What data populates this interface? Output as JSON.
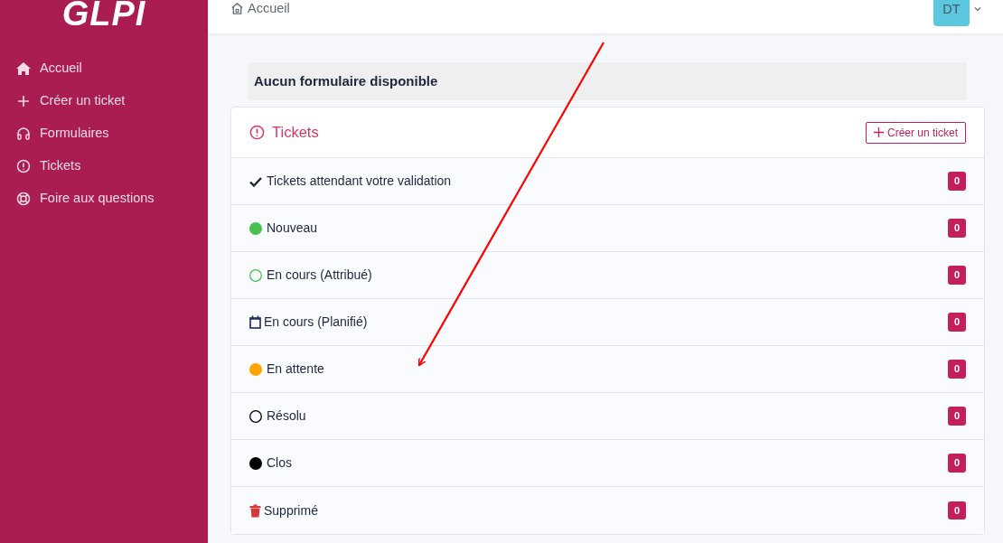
{
  "sidebar": {
    "logo": "GLPI",
    "items": [
      {
        "label": "Accueil",
        "kind": "home"
      },
      {
        "label": "Créer un ticket",
        "kind": "create"
      },
      {
        "label": "Formulaires",
        "kind": "forms"
      },
      {
        "label": "Tickets",
        "kind": "tickets"
      },
      {
        "label": "Foire aux questions",
        "kind": "faq"
      }
    ]
  },
  "header": {
    "breadcrumb": "Accueil",
    "avatar": "DT"
  },
  "notice": "Aucun formulaire disponible",
  "tickets_card": {
    "title": "Tickets",
    "create_button": "Créer un ticket",
    "rows": [
      {
        "kind": "check",
        "label": "Tickets attendant votre validation",
        "count": "0"
      },
      {
        "kind": "dot",
        "color": "#49bf4d",
        "label": "Nouveau",
        "count": "0"
      },
      {
        "kind": "ring",
        "color": "#49bf4d",
        "label": "En cours (Attribué)",
        "count": "0"
      },
      {
        "kind": "calendar",
        "label": "En cours (Planifié)",
        "count": "0"
      },
      {
        "kind": "dot",
        "color": "#ffa500",
        "label": "En attente",
        "count": "0"
      },
      {
        "kind": "ring",
        "color": "#000000",
        "label": "Résolu",
        "count": "0"
      },
      {
        "kind": "dot",
        "color": "#000000",
        "label": "Clos",
        "count": "0"
      },
      {
        "kind": "trash",
        "label": "Supprimé",
        "count": "0"
      }
    ]
  },
  "annotation": {
    "kind": "arrow",
    "color": "#ff0000"
  }
}
